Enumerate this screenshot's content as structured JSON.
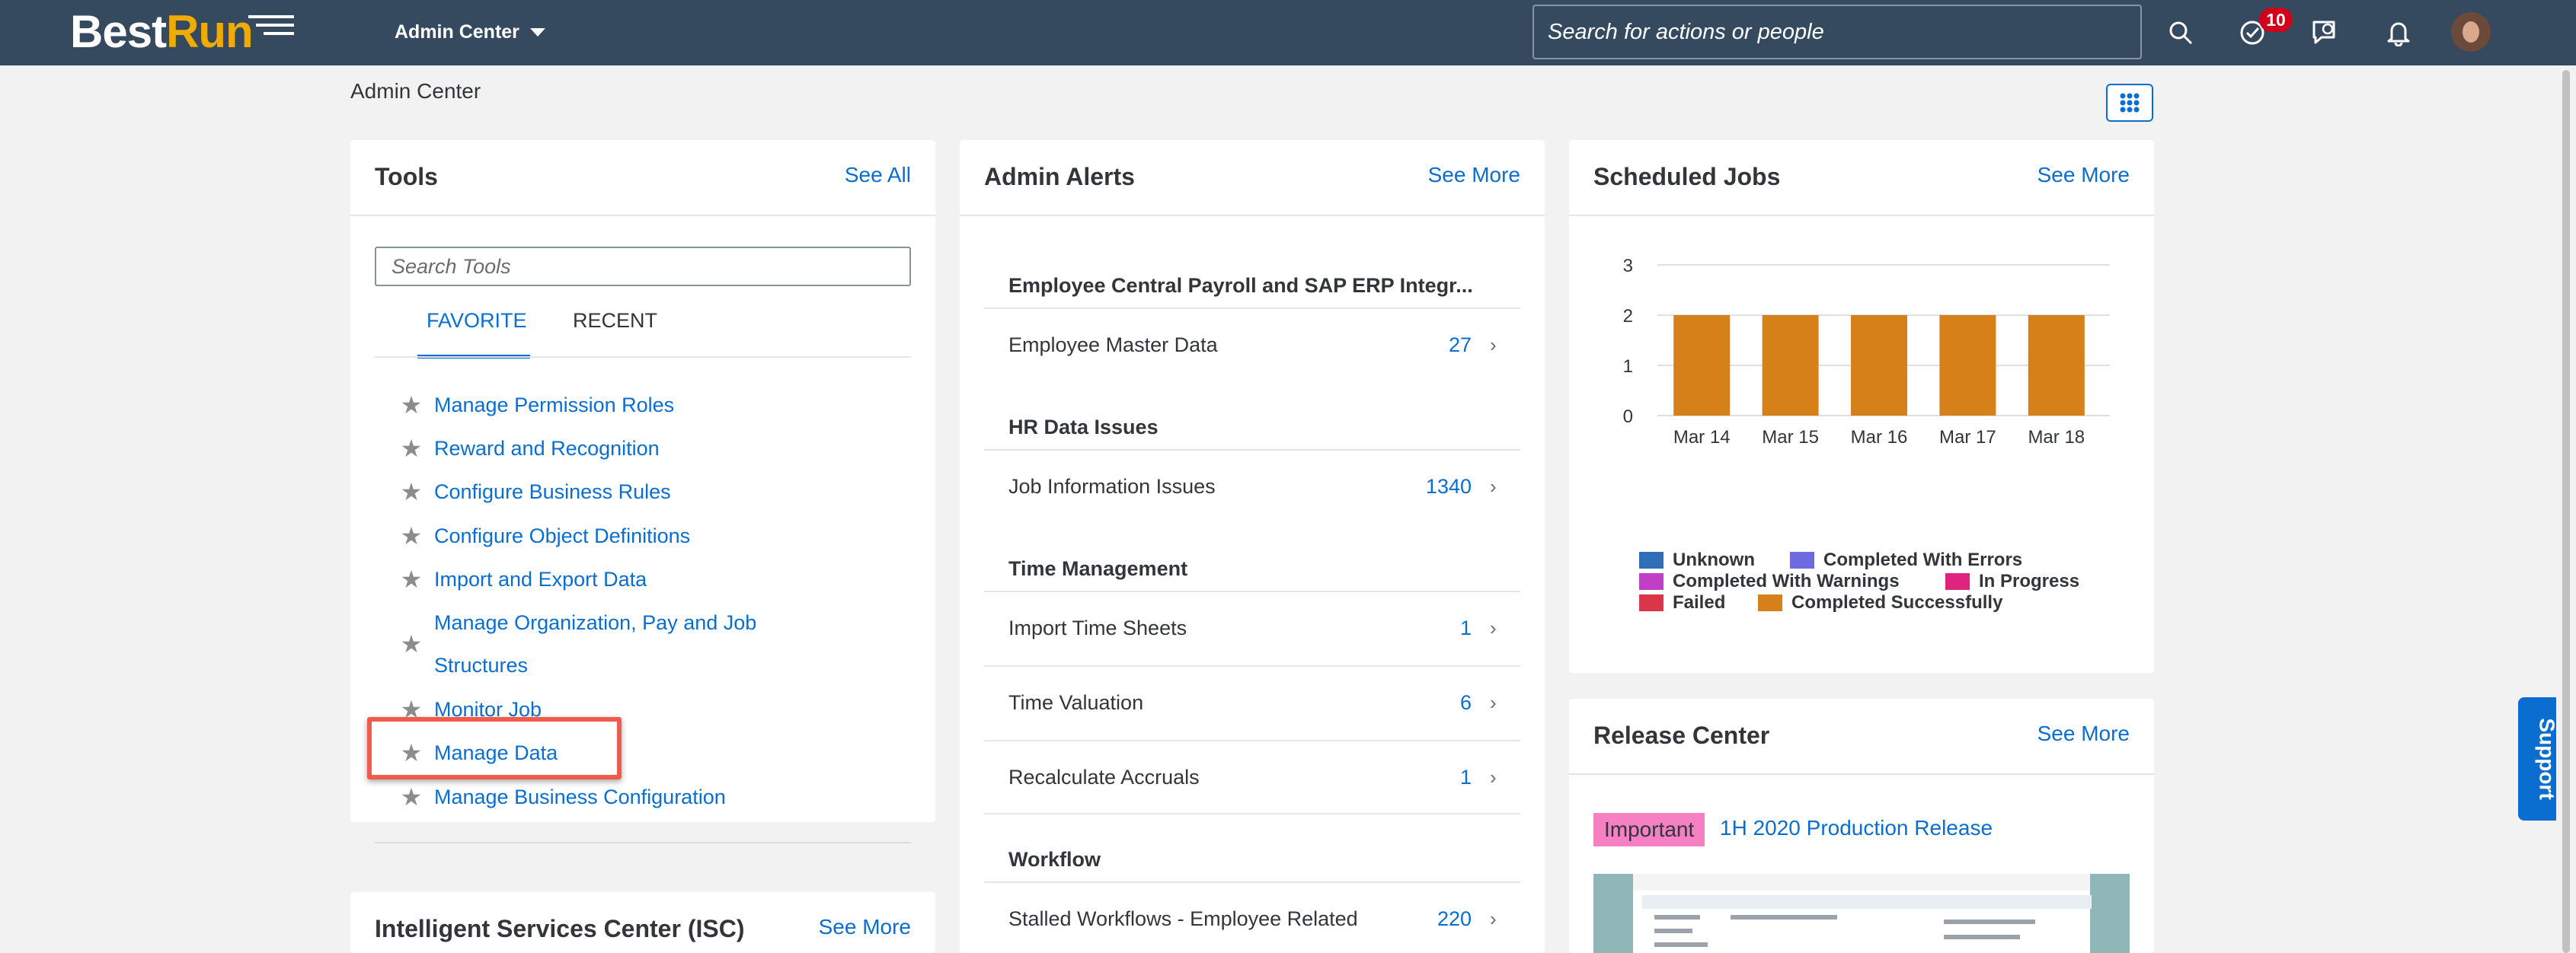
{
  "shell": {
    "logo_best": "Best",
    "logo_run": "Run",
    "menu_label": "Admin Center",
    "search_placeholder": "Search for actions or people",
    "todo_count": "10"
  },
  "page": {
    "title": "Admin Center"
  },
  "tools": {
    "title": "Tools",
    "link": "See All",
    "search_placeholder": "Search Tools",
    "tabs": [
      "FAVORITE",
      "RECENT"
    ],
    "items": [
      "Manage Permission Roles",
      "Reward and Recognition",
      "Configure Business Rules",
      "Configure Object Definitions",
      "Import and Export Data",
      "Manage Organization, Pay and Job",
      "Structures",
      "Monitor Job",
      "Manage Data",
      "Manage Business Configuration"
    ]
  },
  "isc": {
    "title": "Intelligent Services Center (ISC)",
    "link": "See More"
  },
  "alerts": {
    "title": "Admin Alerts",
    "link": "See More",
    "categories": [
      "Employee Central Payroll and SAP ERP Integr...",
      "HR Data Issues",
      "Time Management",
      "Workflow"
    ],
    "rows": [
      {
        "label": "Employee Master Data",
        "value": "27"
      },
      {
        "label": "Job Information Issues",
        "value": "1340"
      },
      {
        "label": "Import Time Sheets",
        "value": "1"
      },
      {
        "label": "Time Valuation",
        "value": "6"
      },
      {
        "label": "Recalculate Accruals",
        "value": "1"
      },
      {
        "label": "Stalled Workflows - Employee Related",
        "value": "220"
      }
    ]
  },
  "jobs": {
    "title": "Scheduled Jobs",
    "link": "See More",
    "legend": [
      {
        "label": "Unknown",
        "color": "#2f6fba"
      },
      {
        "label": "Completed With Errors",
        "color": "#6c6ce0"
      },
      {
        "label": "Completed With Warnings",
        "color": "#c13fc4"
      },
      {
        "label": "In Progress",
        "color": "#e0237e"
      },
      {
        "label": "Failed",
        "color": "#d9364a"
      },
      {
        "label": "Completed Successfully",
        "color": "#d6801a"
      }
    ]
  },
  "chart_data": {
    "type": "bar",
    "categories": [
      "Mar 14",
      "Mar 15",
      "Mar 16",
      "Mar 17",
      "Mar 18"
    ],
    "series": [
      {
        "name": "Completed Successfully",
        "values": [
          2,
          2,
          2,
          2,
          2
        ],
        "color": "#d6801a"
      }
    ],
    "yticks": [
      0,
      1,
      2,
      3
    ],
    "ylim": [
      0,
      3
    ],
    "grid": true,
    "legend_position": "bottom"
  },
  "release": {
    "title": "Release Center",
    "link": "See More",
    "badge": "Important",
    "item": "1H 2020 Production Release"
  },
  "support": {
    "label": "Support"
  }
}
